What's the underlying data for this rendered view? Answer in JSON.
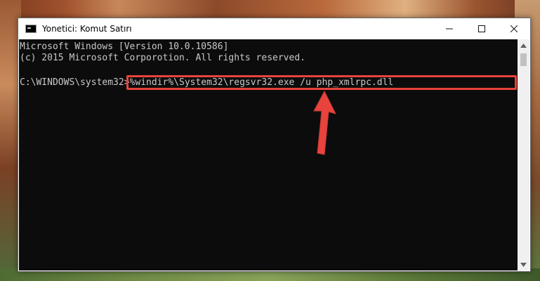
{
  "window": {
    "title": "Yonetici: Komut Satırı",
    "icon": "cmd-icon",
    "controls": [
      "minimize-icon",
      "maximize-icon",
      "close-icon"
    ]
  },
  "console": {
    "lines": [
      "Microsoft Windows [Version 10.0.10586]",
      "(c) 2015 Microsoft Corporotion. All rights reserved."
    ],
    "prompt": "C:\\WINDOWS\\system32>",
    "command": "%windir%\\System32\\regsvr32.exe /u php_xmlrpc.dll",
    "text_color": "#c8c8c8",
    "background": "#0c0c0c"
  },
  "annotation": {
    "highlight_color": "#e8433c",
    "arrow": "arrow-up-icon"
  }
}
